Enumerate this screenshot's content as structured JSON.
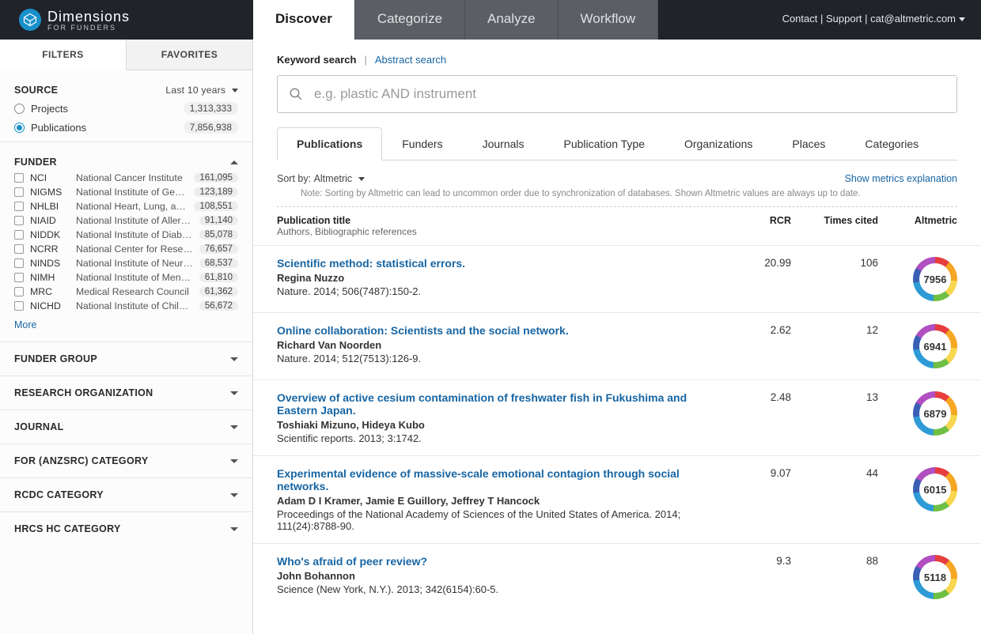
{
  "brand": {
    "name": "Dimensions",
    "sub": "FOR FUNDERS"
  },
  "nav": {
    "tabs": [
      "Discover",
      "Categorize",
      "Analyze",
      "Workflow"
    ],
    "active": 0
  },
  "topright": {
    "contact": "Contact",
    "support": "Support",
    "email": "cat@altmetric.com"
  },
  "sidebar": {
    "tabs": [
      "FILTERS",
      "FAVORITES"
    ],
    "source": {
      "label": "SOURCE",
      "range": "Last 10 years",
      "items": [
        {
          "label": "Projects",
          "count": "1,313,333",
          "checked": false
        },
        {
          "label": "Publications",
          "count": "7,856,938",
          "checked": true
        }
      ]
    },
    "funder": {
      "label": "FUNDER",
      "more": "More",
      "items": [
        {
          "abbr": "NCI",
          "full": "National Cancer Institute",
          "count": "161,095"
        },
        {
          "abbr": "NIGMS",
          "full": "National Institute of General ...",
          "count": "123,189"
        },
        {
          "abbr": "NHLBI",
          "full": "National Heart, Lung, and Blo...",
          "count": "108,551"
        },
        {
          "abbr": "NIAID",
          "full": "National Institute of Allergy a...",
          "count": "91,140"
        },
        {
          "abbr": "NIDDK",
          "full": "National Institute of Diabete...",
          "count": "85,078"
        },
        {
          "abbr": "NCRR",
          "full": "National Center for Research...",
          "count": "76,657"
        },
        {
          "abbr": "NINDS",
          "full": "National Institute of Neurolo...",
          "count": "68,537"
        },
        {
          "abbr": "NIMH",
          "full": "National Institute of Mental ...",
          "count": "61,810"
        },
        {
          "abbr": "MRC",
          "full": "Medical Research Council",
          "count": "61,362"
        },
        {
          "abbr": "NICHD",
          "full": "National Institute of Child He...",
          "count": "56,672"
        }
      ]
    },
    "collapsed": [
      "FUNDER GROUP",
      "RESEARCH ORGANIZATION",
      "JOURNAL",
      "FOR (ANZSRC) CATEGORY",
      "RCDC CATEGORY",
      "HRCS HC CATEGORY"
    ]
  },
  "search": {
    "keyword_label": "Keyword search",
    "abstract_label": "Abstract search",
    "placeholder": "e.g. plastic AND instrument",
    "value": ""
  },
  "subtabs": {
    "items": [
      "Publications",
      "Funders",
      "Journals",
      "Publication Type",
      "Organizations",
      "Places",
      "Categories"
    ],
    "active": 0
  },
  "sort": {
    "label": "Sort by:",
    "value": "Altmetric",
    "right_link": "Show metrics explanation",
    "note": "Note: Sorting by Altmetric can lead to uncommon order due to synchronization of databases. Shown Altmetric values are always up to date."
  },
  "table_head": {
    "title": "Publication title",
    "sub": "Authors, Bibliographic references",
    "rcr": "RCR",
    "tc": "Times cited",
    "alt": "Altmetric"
  },
  "results": [
    {
      "title": "Scientific method: statistical errors.",
      "authors": "Regina Nuzzo",
      "ref": "Nature. 2014; 506(7487):150-2.",
      "rcr": "20.99",
      "tc": "106",
      "alt": "7956"
    },
    {
      "title": "Online collaboration: Scientists and the social network.",
      "authors": "Richard Van Noorden",
      "ref": "Nature. 2014; 512(7513):126-9.",
      "rcr": "2.62",
      "tc": "12",
      "alt": "6941"
    },
    {
      "title": "Overview of active cesium contamination of freshwater fish in Fukushima and Eastern Japan.",
      "authors": "Toshiaki Mizuno, Hideya Kubo",
      "ref": "Scientific reports. 2013; 3:1742.",
      "rcr": "2.48",
      "tc": "13",
      "alt": "6879"
    },
    {
      "title": "Experimental evidence of massive-scale emotional contagion through social networks.",
      "authors": "Adam D I Kramer, Jamie E Guillory, Jeffrey T Hancock",
      "ref": "Proceedings of the National Academy of Sciences of the United States of America. 2014; 111(24):8788-90.",
      "rcr": "9.07",
      "tc": "44",
      "alt": "6015"
    },
    {
      "title": "Who's afraid of peer review?",
      "authors": "John Bohannon",
      "ref": "Science (New York, N.Y.). 2013; 342(6154):60-5.",
      "rcr": "9.3",
      "tc": "88",
      "alt": "5118"
    }
  ]
}
